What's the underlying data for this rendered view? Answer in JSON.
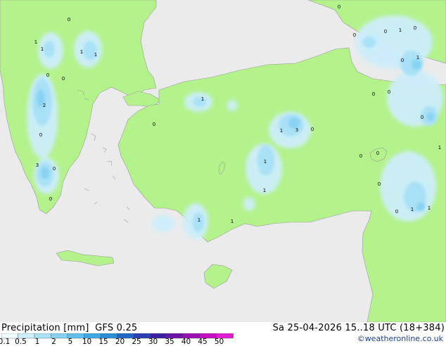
{
  "header": {
    "product": "Precipitation [mm]",
    "model": "GFS 0.25",
    "valid": "Sa 25-04-2026 15..18 UTC (18+384)"
  },
  "legend": {
    "ticks": [
      "0.1",
      "0.5",
      "1",
      "2",
      "5",
      "10",
      "15",
      "20",
      "25",
      "30",
      "35",
      "40",
      "45",
      "50"
    ],
    "colors": [
      "#f0fbff",
      "#cdeefb",
      "#a9e1f7",
      "#86d1f2",
      "#62bfec",
      "#3ea8e4",
      "#2b8fd8",
      "#2167c6",
      "#2c3fb2",
      "#3b1fa0",
      "#6b15a8",
      "#9b10b5",
      "#c40fc0",
      "#e01ed0"
    ]
  },
  "credit": "©weatheronline.co.uk",
  "map": {
    "colors": {
      "sea": "#ebebeb",
      "land": "#b4f28c",
      "coast": "#9a9a9a"
    },
    "labels": [
      "0",
      "1",
      "1",
      "1",
      "1",
      "0",
      "0",
      "2",
      "0",
      "3",
      "0",
      "0",
      "1",
      "0",
      "1",
      "3",
      "0",
      "1",
      "1",
      "1",
      "1",
      "0",
      "1",
      "0",
      "0",
      "0",
      "0",
      "0",
      "1",
      "0",
      "0",
      "0",
      "0",
      "1",
      "0",
      "1",
      "1",
      "0"
    ]
  }
}
